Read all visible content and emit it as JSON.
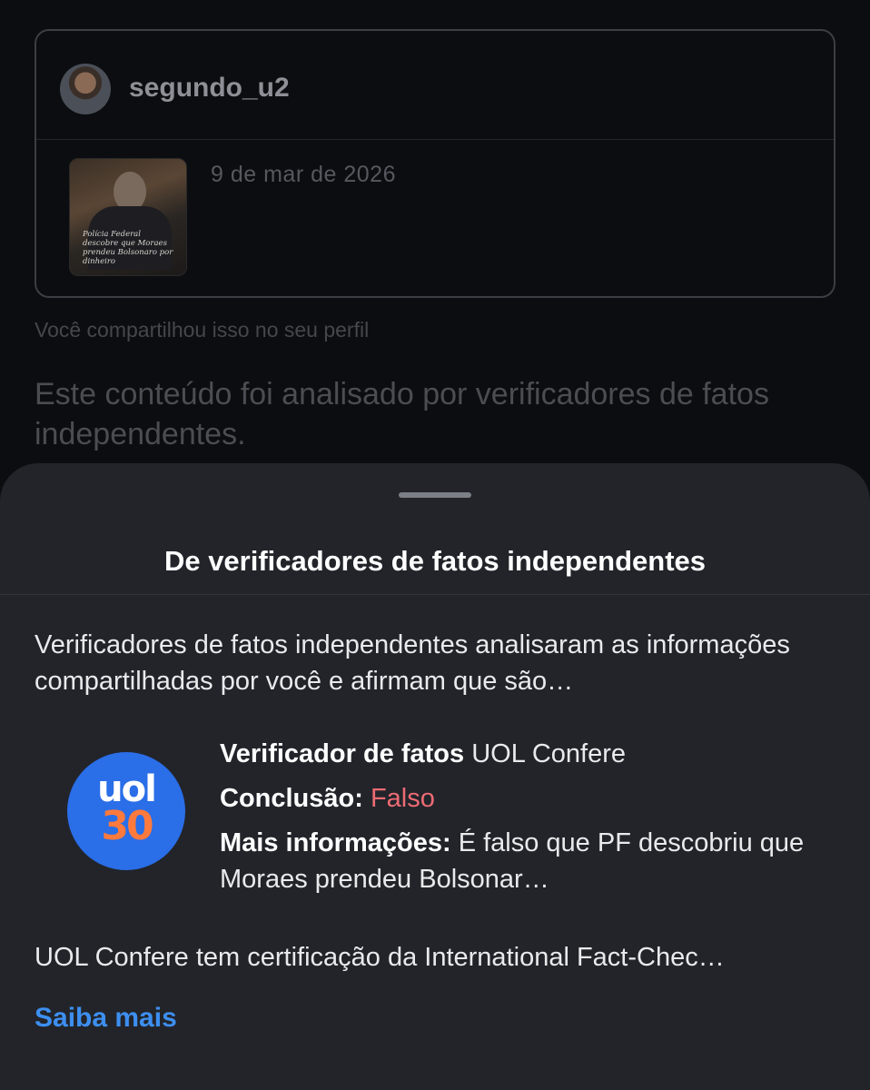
{
  "post": {
    "username": "segundo_u2",
    "date": "9 de mar de 2026",
    "thumbnail_caption": "Polícia Federal descobre que Moraes prendeu Bolsonaro por dinheiro"
  },
  "shared_note": "Você compartilhou isso no seu perfil",
  "analyzed_note": "Este conteúdo foi analisado por verificadores de fatos independentes.",
  "sheet": {
    "title": "De verificadores de fatos independentes",
    "intro": "Verificadores de fatos independentes analisaram as informações compartilhadas por você e afirmam que são…",
    "logo": {
      "line1": "uol",
      "line2": "30"
    },
    "checker_label": "Verificador de fatos",
    "checker_value": "UOL Confere",
    "conclusion_label": "Conclusão:",
    "conclusion_value": "Falso",
    "more_label": "Mais informações:",
    "more_value": "É falso que PF descobriu que Moraes prendeu Bolsonar…",
    "certification": "UOL Confere tem certificação da International Fact-Chec…",
    "learn_more": "Saiba mais"
  },
  "colors": {
    "sheet_bg": "#22242a",
    "falso": "#ec6b73",
    "link": "#3d8ff0",
    "logo_blue": "#2a6ee8"
  }
}
